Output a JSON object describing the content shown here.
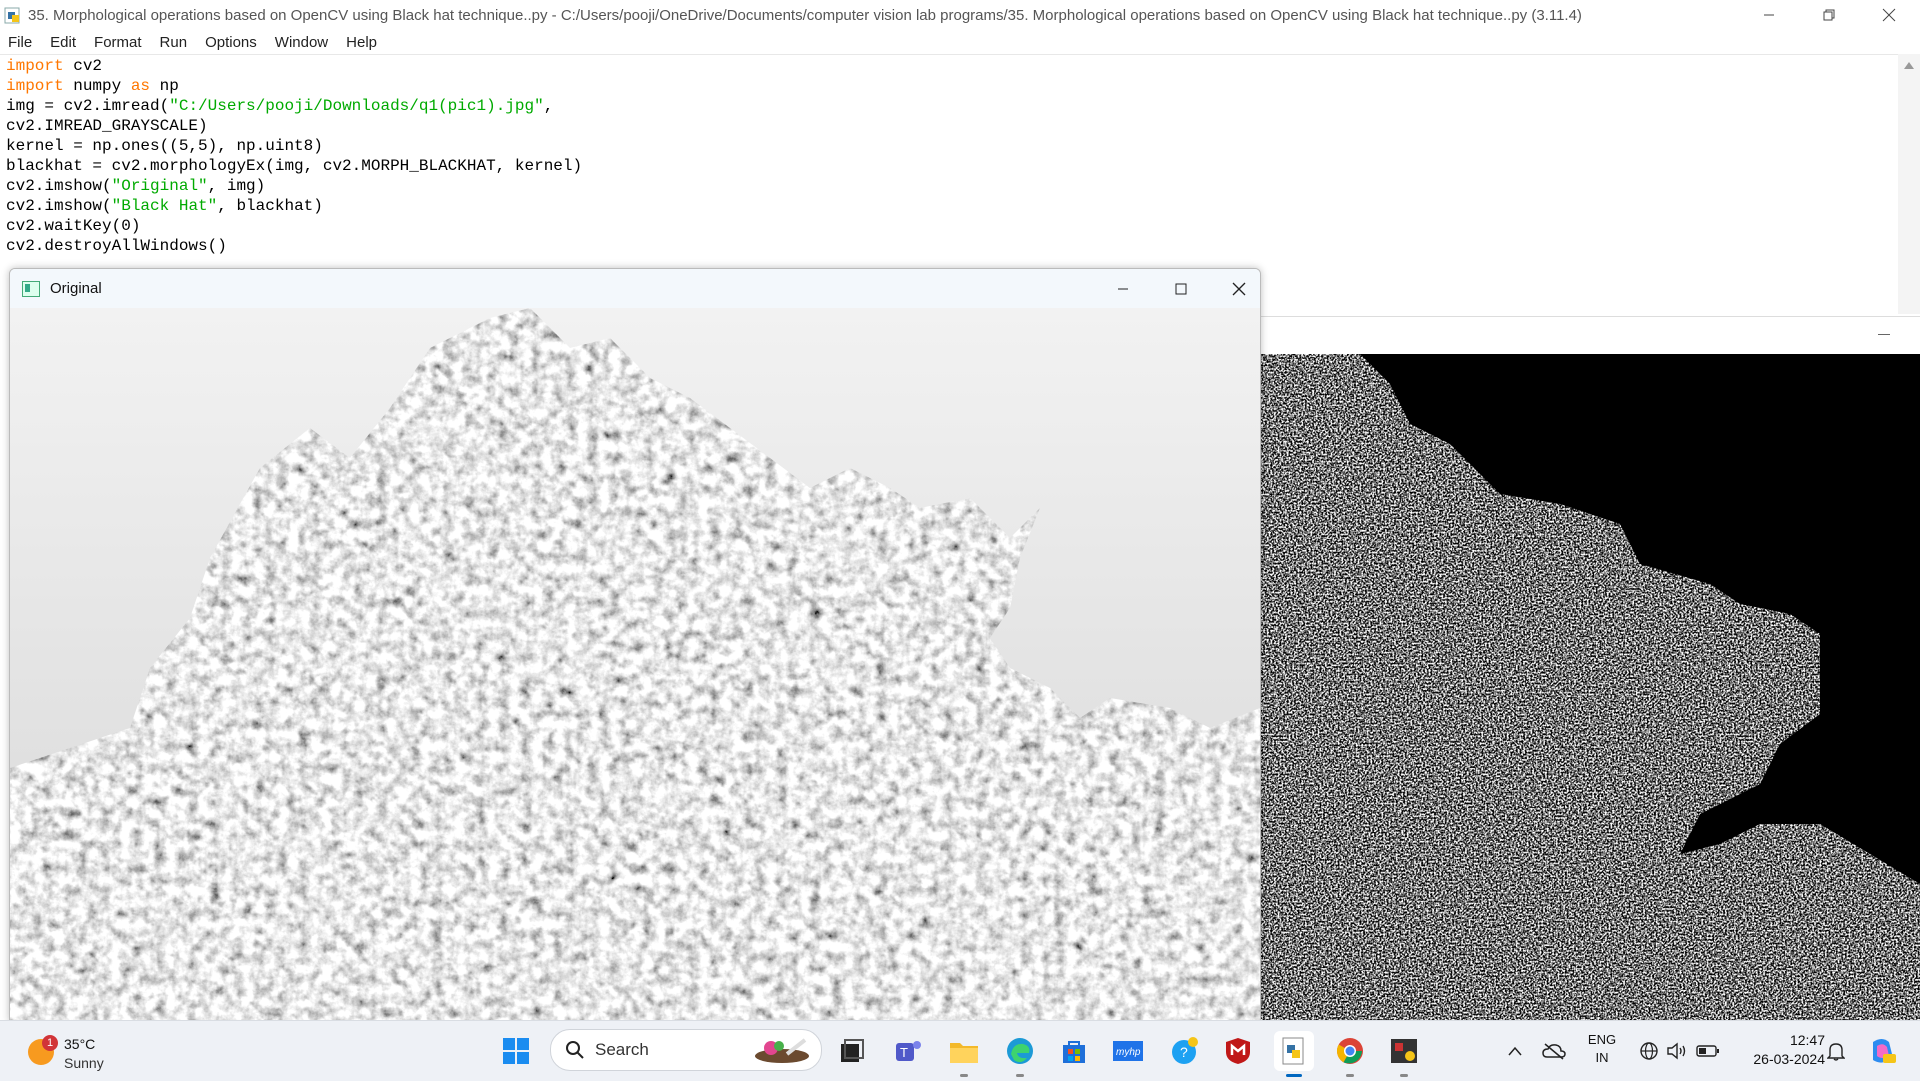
{
  "idle": {
    "title": "35. Morphological operations based on OpenCV using Black hat technique..py - C:/Users/pooji/OneDrive/Documents/computer vision lab programs/35. Morphological operations based on OpenCV using Black hat technique..py (3.11.4)",
    "menu": [
      "File",
      "Edit",
      "Format",
      "Run",
      "Options",
      "Window",
      "Help"
    ],
    "code": {
      "l1_kw": "import",
      "l1_rest": " cv2",
      "l2_kw": "import",
      "l2_mid": " numpy ",
      "l2_kw2": "as",
      "l2_rest": " np",
      "l3_pre": "img = cv2.imread(",
      "l3_str": "\"C:/Users/pooji/Downloads/q1(pic1).jpg\"",
      "l3_post": ",",
      "l4": "cv2.IMREAD_GRAYSCALE)",
      "l5": "kernel = np.ones((5,5), np.uint8)",
      "l6": "blackhat = cv2.morphologyEx(img, cv2.MORPH_BLACKHAT, kernel)",
      "l7_pre": "cv2.imshow(",
      "l7_str": "\"Original\"",
      "l7_post": ", img)",
      "l8_pre": "cv2.imshow(",
      "l8_str": "\"Black Hat\"",
      "l8_post": ", blackhat)",
      "l9": "cv2.waitKey(0)",
      "l10": "cv2.destroyAllWindows()"
    }
  },
  "original_window": {
    "title": "Original"
  },
  "taskbar": {
    "weather_temp": "35°C",
    "weather_cond": "Sunny",
    "weather_badge": "1",
    "search_label": "Search",
    "lang_top": "ENG",
    "lang_bottom": "IN",
    "time": "12:47",
    "date": "26-03-2024"
  },
  "colors": {
    "keyword": "#ff7700",
    "string": "#00aa00",
    "taskbar_bg": "#eef1f6",
    "accent": "#0067c0"
  }
}
